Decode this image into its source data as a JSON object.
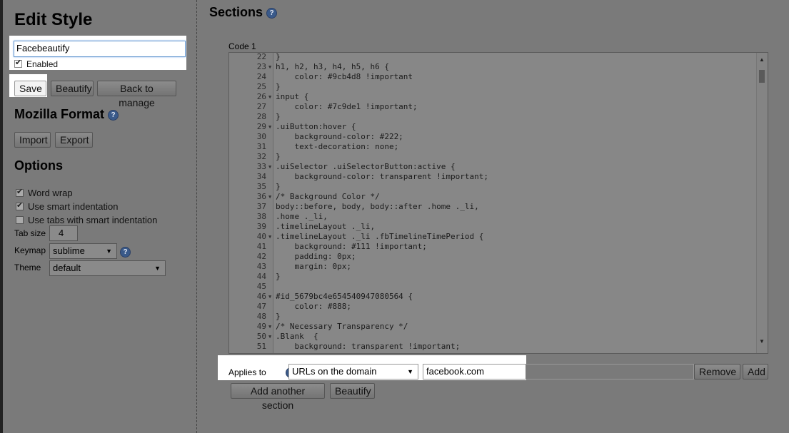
{
  "sidebar": {
    "title": "Edit Style",
    "style_name": "Facebeautify",
    "enabled_label": "Enabled",
    "enabled_checked": true,
    "save_label": "Save",
    "beautify_label": "Beautify",
    "back_label": "Back to manage",
    "mozilla_format_title": "Mozilla Format",
    "import_label": "Import",
    "export_label": "Export",
    "options_title": "Options",
    "options": [
      {
        "label": "Word wrap",
        "checked": true
      },
      {
        "label": "Use smart indentation",
        "checked": true
      },
      {
        "label": "Use tabs with smart indentation",
        "checked": false
      }
    ],
    "tab_size_label": "Tab size",
    "tab_size_value": "4",
    "keymap_label": "Keymap",
    "keymap_value": "sublime",
    "theme_label": "Theme",
    "theme_value": "default"
  },
  "main": {
    "title": "Sections",
    "code_label": "Code 1",
    "code_lines": [
      {
        "n": "22",
        "fold": false,
        "text": "}"
      },
      {
        "n": "23",
        "fold": true,
        "text": "h1, h2, h3, h4, h5, h6 {"
      },
      {
        "n": "24",
        "fold": false,
        "text": "    color: #9cb4d8 !important"
      },
      {
        "n": "25",
        "fold": false,
        "text": "}"
      },
      {
        "n": "26",
        "fold": true,
        "text": "input {"
      },
      {
        "n": "27",
        "fold": false,
        "text": "    color: #7c9de1 !important;"
      },
      {
        "n": "28",
        "fold": false,
        "text": "}"
      },
      {
        "n": "29",
        "fold": true,
        "text": ".uiButton:hover {"
      },
      {
        "n": "30",
        "fold": false,
        "text": "    background-color: #222;"
      },
      {
        "n": "31",
        "fold": false,
        "text": "    text-decoration: none;"
      },
      {
        "n": "32",
        "fold": false,
        "text": "}"
      },
      {
        "n": "33",
        "fold": true,
        "text": ".uiSelector .uiSelectorButton:active {"
      },
      {
        "n": "34",
        "fold": false,
        "text": "    background-color: transparent !important;"
      },
      {
        "n": "35",
        "fold": false,
        "text": "}"
      },
      {
        "n": "36",
        "fold": true,
        "text": "/* Background Color */"
      },
      {
        "n": "37",
        "fold": false,
        "text": "body::before, body, body::after .home ._li,"
      },
      {
        "n": "38",
        "fold": false,
        "text": ".home ._li,"
      },
      {
        "n": "39",
        "fold": false,
        "text": ".timelineLayout ._li,"
      },
      {
        "n": "40",
        "fold": true,
        "text": ".timelineLayout ._li .fbTimelineTimePeriod {"
      },
      {
        "n": "41",
        "fold": false,
        "text": "    background: #111 !important;"
      },
      {
        "n": "42",
        "fold": false,
        "text": "    padding: 0px;"
      },
      {
        "n": "43",
        "fold": false,
        "text": "    margin: 0px;"
      },
      {
        "n": "44",
        "fold": false,
        "text": "}"
      },
      {
        "n": "45",
        "fold": false,
        "text": ""
      },
      {
        "n": "46",
        "fold": true,
        "text": "#id_5679bc4e654540947080564 {"
      },
      {
        "n": "47",
        "fold": false,
        "text": "    color: #888;"
      },
      {
        "n": "48",
        "fold": false,
        "text": "}"
      },
      {
        "n": "49",
        "fold": true,
        "text": "/* Necessary Transparency */"
      },
      {
        "n": "50",
        "fold": true,
        "text": ".Blank  {"
      },
      {
        "n": "51",
        "fold": false,
        "text": "    background: transparent !important;"
      }
    ],
    "applies_to_label": "Applies to",
    "applies_type": "URLs on the domain",
    "applies_value": "facebook.com",
    "remove_label": "Remove",
    "add_label": "Add",
    "add_section_label": "Add another section",
    "beautify_label": "Beautify"
  }
}
